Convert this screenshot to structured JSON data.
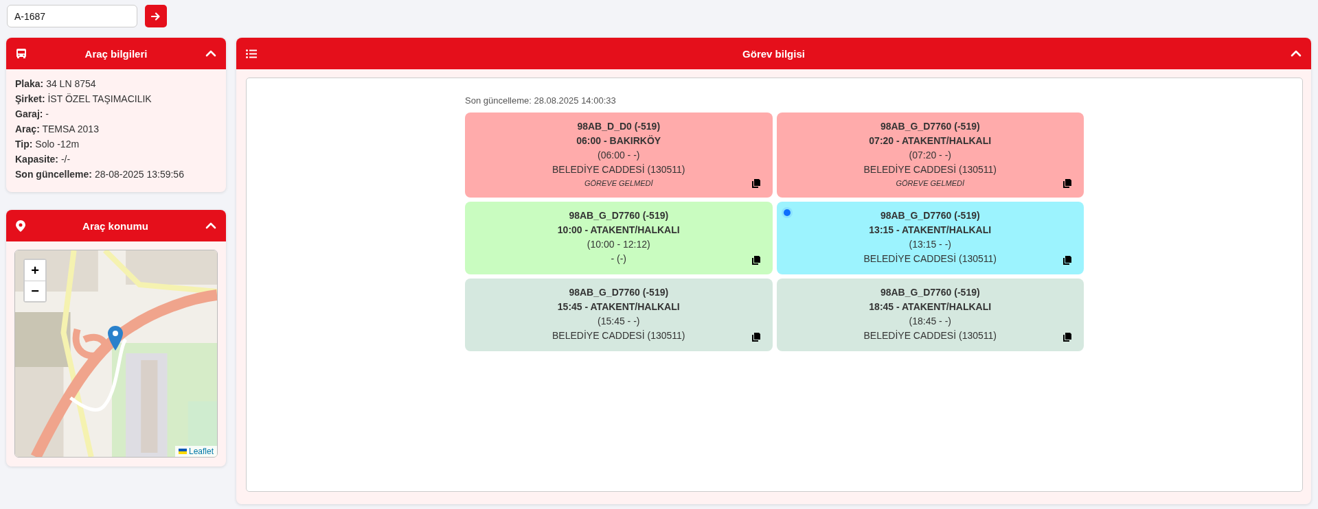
{
  "search": {
    "value": "A-1687"
  },
  "vehicle_panel": {
    "title": "Araç bilgileri",
    "expanded": true,
    "lines": [
      "**Plaka:** 34 LN 8754",
      "**Şirket:** İST ÖZEL TAŞIMACILIK",
      "**Garaj:** -",
      "**Araç:** TEMSA 2013",
      "**Tip:** Solo -12m",
      "**Kapasite:** -/-",
      "**Son güncelleme:** 28-08-2025 13:59:56"
    ]
  },
  "location_panel": {
    "title": "Araç konumu",
    "expanded": true,
    "map": {
      "zoom_in": "+",
      "zoom_out": "−",
      "attribution": "Leaflet"
    }
  },
  "task_panel": {
    "title": "Görev bilgisi",
    "expanded": true,
    "updated": "Son güncelleme: 28.08.2025 14:00:33",
    "cards": [
      {
        "code": "98AB_D_D0 (-519)",
        "trip": "06:00 - BAKIRKÖY",
        "times": "(06:00 - -)",
        "stop": "BELEDİYE CADDESİ (130511)",
        "note": "GÖREVE GELMEDİ",
        "color": "#ffabab",
        "current": false
      },
      {
        "code": "98AB_G_D7760 (-519)",
        "trip": "07:20 - ATAKENT/HALKALI",
        "times": "(07:20 - -)",
        "stop": "BELEDİYE CADDESİ (130511)",
        "note": "GÖREVE GELMEDİ",
        "color": "#ffabab",
        "current": false
      },
      {
        "code": "98AB_G_D7760 (-519)",
        "trip": "10:00 - ATAKENT/HALKALI",
        "times": "(10:00 - 12:12)",
        "stop": "- (-)",
        "color": "#c9fcc0",
        "current": false
      },
      {
        "code": "98AB_G_D7760 (-519)",
        "trip": "13:15 - ATAKENT/HALKALI",
        "times": "(13:15 - -)",
        "stop": "BELEDİYE CADDESİ (130511)",
        "color": "#9cf3fe",
        "current": true
      },
      {
        "code": "98AB_G_D7760 (-519)",
        "trip": "15:45 - ATAKENT/HALKALI",
        "times": "(15:45 - -)",
        "stop": "BELEDİYE CADDESİ (130511)",
        "color": "#d5e8df",
        "current": false
      },
      {
        "code": "98AB_G_D7760 (-519)",
        "trip": "18:45 - ATAKENT/HALKALI",
        "times": "(18:45 - -)",
        "stop": "BELEDİYE CADDESİ (130511)",
        "color": "#d5e8df",
        "current": false
      }
    ]
  }
}
